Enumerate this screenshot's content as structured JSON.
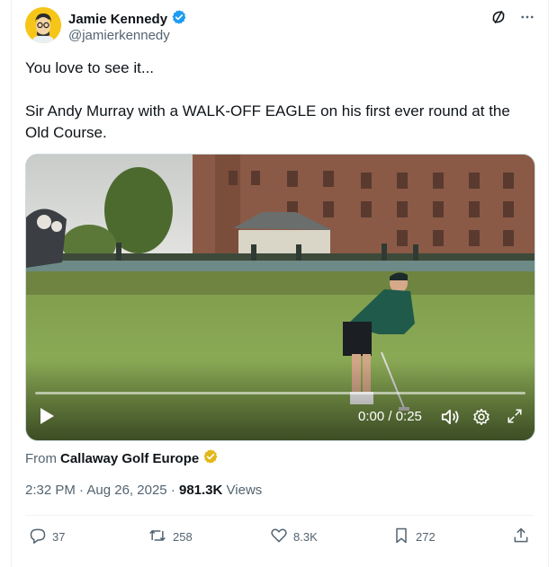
{
  "author": {
    "name": "Jamie Kennedy",
    "handle": "@jamierkennedy"
  },
  "tweet": {
    "text": "You love to see it...\n\nSir Andy Murray with a WALK-OFF EAGLE on his first ever round at the Old Course."
  },
  "video": {
    "time": "0:00 / 0:25",
    "progress": 0
  },
  "source": {
    "prefix": "From",
    "name": "Callaway Golf Europe"
  },
  "meta": {
    "time": "2:32 PM",
    "date": "Aug 26, 2025",
    "views_count": "981.3K",
    "views_label": "Views"
  },
  "actions": {
    "replies": "37",
    "reposts": "258",
    "likes": "8.3K",
    "bookmarks": "272"
  },
  "colors": {
    "verified": "#1d9bf0",
    "gold_badge": "#e2b719",
    "muted": "#536471"
  },
  "icons": [
    "grok-icon",
    "more-icon",
    "play-icon",
    "volume-icon",
    "settings-icon",
    "fullscreen-icon",
    "reply-icon",
    "repost-icon",
    "like-icon",
    "bookmark-icon",
    "share-icon"
  ]
}
